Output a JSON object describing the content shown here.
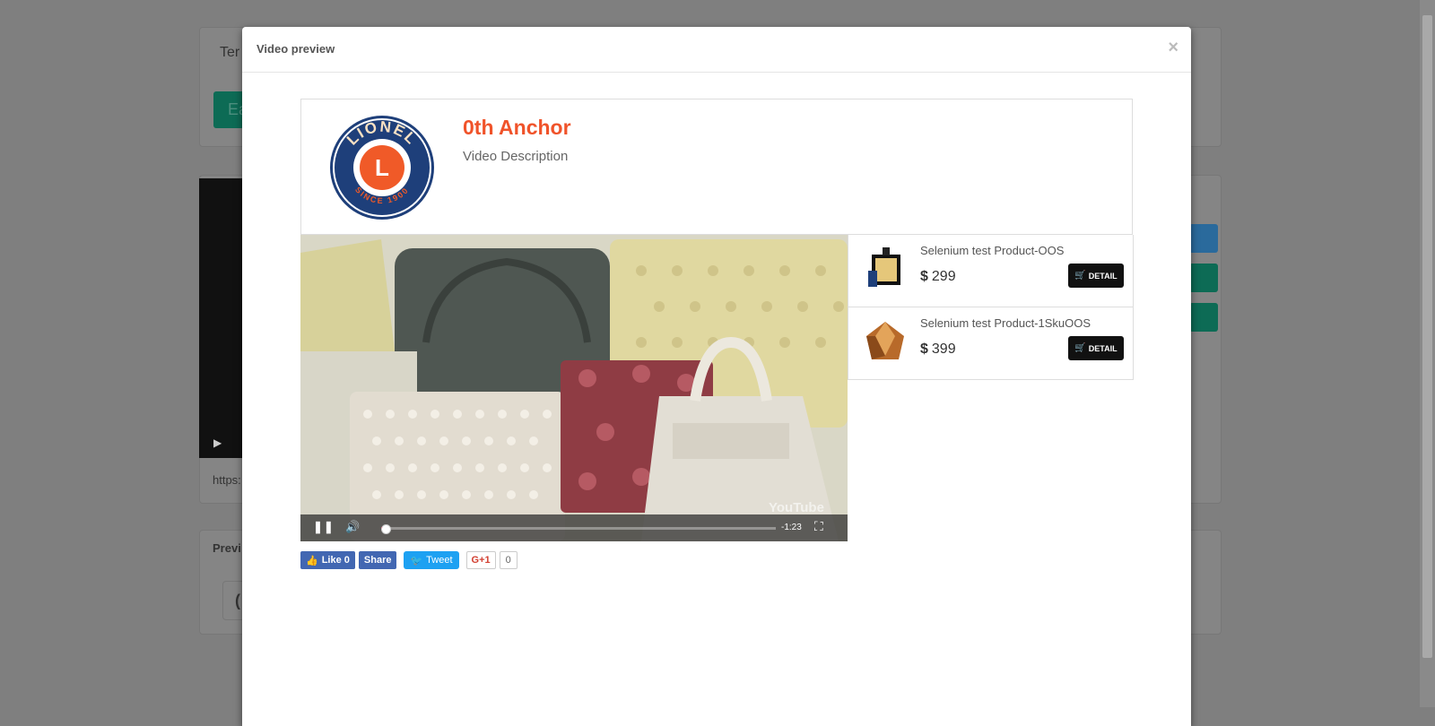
{
  "background": {
    "panel_title": "Ter",
    "green_button": "Ea",
    "url_text": "https:",
    "preview_label": "Previ",
    "input_text": "("
  },
  "modal": {
    "title": "Video preview",
    "close_label": "×"
  },
  "anchor": {
    "name": "0th Anchor",
    "description": "Video Description",
    "logo": {
      "top_text": "LIONEL",
      "bottom_text": "SINCE 1900",
      "letter": "L"
    }
  },
  "video": {
    "time_remaining": "-1:23",
    "progress_fraction": 0.01,
    "buffered_fraction": 0.33,
    "watermark": "YouTube"
  },
  "products": [
    {
      "name": "Selenium test Product-OOS",
      "currency": "$",
      "price": "299",
      "detail_label": "DETAIL"
    },
    {
      "name": "Selenium test Product-1SkuOOS",
      "currency": "$",
      "price": "399",
      "detail_label": "DETAIL"
    }
  ],
  "social": {
    "like_label": "Like 0",
    "share_label": "Share",
    "tweet_label": "Tweet",
    "gplus_label": "G+1",
    "gplus_count": "0"
  },
  "colors": {
    "anchor_name": "#f0532a",
    "facebook": "#4267b2",
    "twitter": "#1da1f2",
    "logo_blue": "#1e3f7a",
    "logo_orange": "#f05a28"
  }
}
